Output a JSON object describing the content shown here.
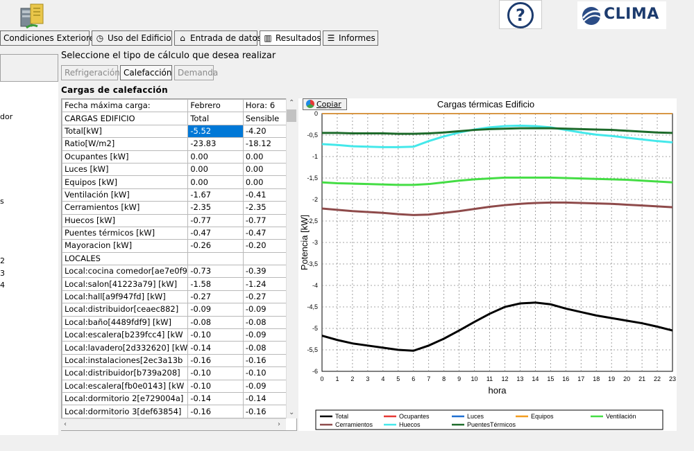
{
  "header": {
    "logo_text": "CLIMA",
    "help_label": "?"
  },
  "tabs": [
    {
      "label": "Condiciones Exteriores",
      "icon": ""
    },
    {
      "label": "Uso del Edificio",
      "icon": "clock-icon"
    },
    {
      "label": "Entrada de datos",
      "icon": "house-icon"
    },
    {
      "label": "Resultados",
      "icon": "bar-chart-icon"
    },
    {
      "label": "Informes",
      "icon": "list-icon"
    }
  ],
  "left_tree": [
    "dor",
    "s",
    "2",
    "3",
    "4"
  ],
  "calc": {
    "prompt": "Seleccione el tipo de cálculo que desea realizar",
    "buttons": [
      "Refrigeración",
      "Calefacción",
      "Demanda"
    ],
    "active": "Calefacción"
  },
  "section_title": "Cargas de calefacción",
  "grid": {
    "rows": [
      [
        "Fecha máxima carga:",
        "Febrero",
        "Hora: 6"
      ],
      [
        "CARGAS EDIFICIO",
        "Total",
        "Sensible"
      ],
      [
        "Total[kW]",
        "-5.52",
        "-4.20"
      ],
      [
        "Ratio[W/m2]",
        "-23.83",
        "-18.12"
      ],
      [
        "Ocupantes [kW]",
        "0.00",
        "0.00"
      ],
      [
        "Luces [kW]",
        "0.00",
        "0.00"
      ],
      [
        "Equipos [kW]",
        "0.00",
        "0.00"
      ],
      [
        "Ventilación [kW]",
        "-1.67",
        "-0.41"
      ],
      [
        "Cerramientos [kW]",
        "-2.35",
        "-2.35"
      ],
      [
        "Huecos [kW]",
        "-0.77",
        "-0.77"
      ],
      [
        "Puentes térmicos [kW]",
        "-0.47",
        "-0.47"
      ],
      [
        "Mayoracion [kW]",
        "-0.26",
        "-0.20"
      ],
      [
        "LOCALES",
        "",
        ""
      ],
      [
        "Local:cocina comedor[ae7e0f9",
        "-0.73",
        "-0.39"
      ],
      [
        "Local:salon[41223a79] [kW]",
        "-1.58",
        "-1.24"
      ],
      [
        "Local:hall[a9f947fd] [kW]",
        "-0.27",
        "-0.27"
      ],
      [
        "Local:distribuidor[ceaec882]",
        "-0.09",
        "-0.09"
      ],
      [
        "Local:baño[4489fdf9] [kW]",
        "-0.08",
        "-0.08"
      ],
      [
        "Local:escalera[b239fcc4] [kW",
        "-0.10",
        "-0.09"
      ],
      [
        "Local:lavadero[2d332620] [kW",
        "-0.14",
        "-0.08"
      ],
      [
        "Local:instalaciones[2ec3a13b",
        "-0.16",
        "-0.16"
      ],
      [
        "Local:distribuidor[b739a208]",
        "-0.10",
        "-0.10"
      ],
      [
        "Local:escalera[fb0e0143] [kW",
        "-0.10",
        "-0.09"
      ],
      [
        "Local:dormitorio 2[e729004a]",
        "-0.14",
        "-0.14"
      ],
      [
        "Local:dormitorio 3[def63854]",
        "-0.16",
        "-0.16"
      ]
    ]
  },
  "copy_label": "Copiar",
  "chart_data": {
    "type": "line",
    "title": "Cargas térmicas Edificio",
    "xlabel": "hora",
    "ylabel": "Potencia [kW]",
    "xlim": [
      0,
      23
    ],
    "ylim": [
      -6,
      0
    ],
    "x": [
      0,
      1,
      2,
      3,
      4,
      5,
      6,
      7,
      8,
      9,
      10,
      11,
      12,
      13,
      14,
      15,
      16,
      17,
      18,
      19,
      20,
      21,
      22,
      23
    ],
    "yticks": [
      "0",
      "-0,5",
      "-1",
      "-1,5",
      "-2",
      "-2,5",
      "-3",
      "-3,5",
      "-4",
      "-4,5",
      "-5",
      "-5,5",
      "-6"
    ],
    "grid": true,
    "legend_position": "bottom",
    "series": [
      {
        "name": "Total",
        "color": "#000000",
        "values": [
          -5.17,
          -5.27,
          -5.35,
          -5.4,
          -5.45,
          -5.5,
          -5.52,
          -5.4,
          -5.24,
          -5.05,
          -4.85,
          -4.66,
          -4.5,
          -4.42,
          -4.4,
          -4.44,
          -4.54,
          -4.62,
          -4.7,
          -4.76,
          -4.82,
          -4.88,
          -4.96,
          -5.05
        ]
      },
      {
        "name": "Ocupantes",
        "color": "#e53935",
        "values": [
          0,
          0,
          0,
          0,
          0,
          0,
          0,
          0,
          0,
          0,
          0,
          0,
          0,
          0,
          0,
          0,
          0,
          0,
          0,
          0,
          0,
          0,
          0,
          0
        ]
      },
      {
        "name": "Luces",
        "color": "#1f6fd1",
        "values": [
          0,
          0,
          0,
          0,
          0,
          0,
          0,
          0,
          0,
          0,
          0,
          0,
          0,
          0,
          0,
          0,
          0,
          0,
          0,
          0,
          0,
          0,
          0,
          0
        ]
      },
      {
        "name": "Equipos",
        "color": "#f29c1f",
        "values": [
          0,
          0,
          0,
          0,
          0,
          0,
          0,
          0,
          0,
          0,
          0,
          0,
          0,
          0,
          0,
          0,
          0,
          0,
          0,
          0,
          0,
          0,
          0,
          0
        ]
      },
      {
        "name": "Ventilación",
        "color": "#44dd44",
        "values": [
          -1.6,
          -1.62,
          -1.63,
          -1.64,
          -1.65,
          -1.66,
          -1.66,
          -1.64,
          -1.6,
          -1.56,
          -1.53,
          -1.51,
          -1.49,
          -1.49,
          -1.49,
          -1.49,
          -1.5,
          -1.51,
          -1.52,
          -1.53,
          -1.54,
          -1.56,
          -1.58,
          -1.6
        ]
      },
      {
        "name": "Cerramientos",
        "color": "#8e4a4a",
        "values": [
          -2.21,
          -2.24,
          -2.27,
          -2.29,
          -2.31,
          -2.34,
          -2.36,
          -2.35,
          -2.31,
          -2.27,
          -2.22,
          -2.17,
          -2.13,
          -2.1,
          -2.08,
          -2.07,
          -2.07,
          -2.08,
          -2.09,
          -2.1,
          -2.12,
          -2.14,
          -2.16,
          -2.18
        ]
      },
      {
        "name": "Huecos",
        "color": "#44e8ea",
        "values": [
          -0.71,
          -0.73,
          -0.76,
          -0.77,
          -0.78,
          -0.78,
          -0.77,
          -0.64,
          -0.53,
          -0.44,
          -0.37,
          -0.32,
          -0.29,
          -0.28,
          -0.29,
          -0.32,
          -0.38,
          -0.44,
          -0.49,
          -0.52,
          -0.56,
          -0.6,
          -0.64,
          -0.67
        ]
      },
      {
        "name": "PuentesTérmicos",
        "color": "#1d6a2a",
        "values": [
          -0.45,
          -0.45,
          -0.46,
          -0.46,
          -0.46,
          -0.47,
          -0.47,
          -0.46,
          -0.44,
          -0.41,
          -0.38,
          -0.36,
          -0.35,
          -0.34,
          -0.34,
          -0.34,
          -0.35,
          -0.36,
          -0.37,
          -0.38,
          -0.4,
          -0.42,
          -0.44,
          -0.45
        ]
      }
    ]
  }
}
